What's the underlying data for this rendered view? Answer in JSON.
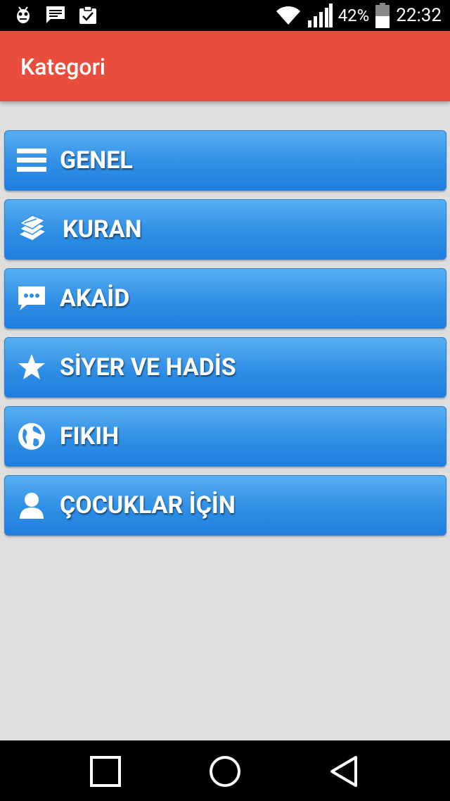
{
  "status_bar": {
    "battery_percent": "42%",
    "time": "22:32",
    "icons": [
      "bug-icon",
      "message-icon",
      "clipboard-check-icon",
      "wifi-icon",
      "signal-icon",
      "battery-icon"
    ]
  },
  "app_bar": {
    "title": "Kategori"
  },
  "categories": [
    {
      "label": "GENEL",
      "icon": "menu-icon"
    },
    {
      "label": "KURAN",
      "icon": "book-icon"
    },
    {
      "label": "AKAİD",
      "icon": "chat-icon"
    },
    {
      "label": "SİYER VE HADİS",
      "icon": "star-icon"
    },
    {
      "label": "FIKIH",
      "icon": "globe-icon"
    },
    {
      "label": "ÇOCUKLAR İÇİN",
      "icon": "user-icon"
    }
  ],
  "nav_bar": {
    "buttons": [
      "recent-apps-icon",
      "home-icon",
      "back-icon"
    ]
  },
  "colors": {
    "app_bar": "#e84d3d",
    "button": "#2f8fe6",
    "background": "#dedede"
  }
}
